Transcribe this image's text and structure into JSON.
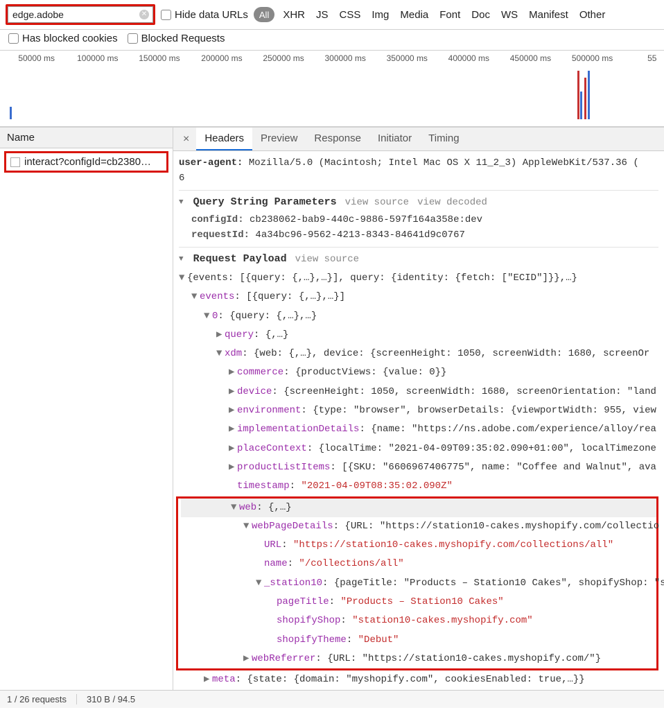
{
  "filter": {
    "value": "edge.adobe",
    "hide_data_urls": "Hide data URLs",
    "type_all": "All",
    "types": [
      "XHR",
      "JS",
      "CSS",
      "Img",
      "Media",
      "Font",
      "Doc",
      "WS",
      "Manifest",
      "Other"
    ],
    "has_blocked_cookies": "Has blocked cookies",
    "blocked_requests": "Blocked Requests"
  },
  "timeline": {
    "ticks": [
      "50000 ms",
      "100000 ms",
      "150000 ms",
      "200000 ms",
      "250000 ms",
      "300000 ms",
      "350000 ms",
      "400000 ms",
      "450000 ms",
      "500000 ms",
      "55"
    ]
  },
  "left": {
    "header": "Name",
    "request": "interact?configId=cb2380…"
  },
  "tabs": {
    "items": [
      "Headers",
      "Preview",
      "Response",
      "Initiator",
      "Timing"
    ],
    "active": 0
  },
  "headers": {
    "ua_key": "user-agent:",
    "ua_val": "Mozilla/5.0 (Macintosh; Intel Mac OS X 11_2_3) AppleWebKit/537.36 (",
    "ua_line2": "6"
  },
  "qsp": {
    "title": "Query String Parameters",
    "view_source": "view source",
    "view_decoded": "view decoded",
    "configId_k": "configId:",
    "configId_v": "cb238062-bab9-440c-9886-597f164a358e:dev",
    "requestId_k": "requestId:",
    "requestId_v": "4a34bc96-9562-4213-8343-84641d9c0767"
  },
  "payload": {
    "title": "Request Payload",
    "view_source": "view source",
    "root": "{events: [{query: {,…},…}], query: {identity: {fetch: [\"ECID\"]}},…}",
    "events_k": "events",
    "events_v": ": [{query: {,…},…}]",
    "zero_k": "0",
    "zero_v": ": {query: {,…},…}",
    "query_k": "query",
    "query_v": ": {,…}",
    "xdm_k": "xdm",
    "xdm_v": ": {web: {,…}, device: {screenHeight: 1050, screenWidth: 1680, screenOr",
    "commerce_k": "commerce",
    "commerce_v": ": {productViews: {value: 0}}",
    "device_k": "device",
    "device_v": ": {screenHeight: 1050, screenWidth: 1680, screenOrientation: \"land",
    "environment_k": "environment",
    "environment_v": ": {type: \"browser\", browserDetails: {viewportWidth: 955, view",
    "impl_k": "implementationDetails",
    "impl_v": ": {name: \"https://ns.adobe.com/experience/alloy/rea",
    "place_k": "placeContext",
    "place_v": ": {localTime: \"2021-04-09T09:35:02.090+01:00\", localTimezone",
    "plist_k": "productListItems",
    "plist_v": ": [{SKU: \"6606967406775\", name: \"Coffee and Walnut\", ava",
    "ts_k": "timestamp",
    "ts_v_pre": ": ",
    "ts_v": "\"2021-04-09T08:35:02.090Z\"",
    "web_k": "web",
    "web_v": ": {,…}",
    "wpd_k": "webPageDetails",
    "wpd_v": ": {URL: \"https://station10-cakes.myshopify.com/collectio",
    "url_k": "URL",
    "url_pre": ": ",
    "url_v": "\"https://station10-cakes.myshopify.com/collections/all\"",
    "name_k": "name",
    "name_pre": ": ",
    "name_v": "\"/collections/all\"",
    "s10_k": "_station10",
    "s10_v": ": {pageTitle: \"Products – Station10 Cakes\", shopifyShop: \"s",
    "pt_k": "pageTitle",
    "pt_pre": ": ",
    "pt_v": "\"Products – Station10 Cakes\"",
    "ss_k": "shopifyShop",
    "ss_pre": ": ",
    "ss_v": "\"station10-cakes.myshopify.com\"",
    "st_k": "shopifyTheme",
    "st_pre": ": ",
    "st_v": "\"Debut\"",
    "wref_k": "webReferrer",
    "wref_v": ": {URL: \"https://station10-cakes.myshopify.com/\"}",
    "meta_k": "meta",
    "meta_v": ": {state: {domain: \"myshopify.com\", cookiesEnabled: true,…}}",
    "q2_k": "query",
    "q2_v": ": {identity: {fetch: [\"ECID\"]}}"
  },
  "status": {
    "requests": "1 / 26 requests",
    "size": "310 B / 94.5"
  }
}
